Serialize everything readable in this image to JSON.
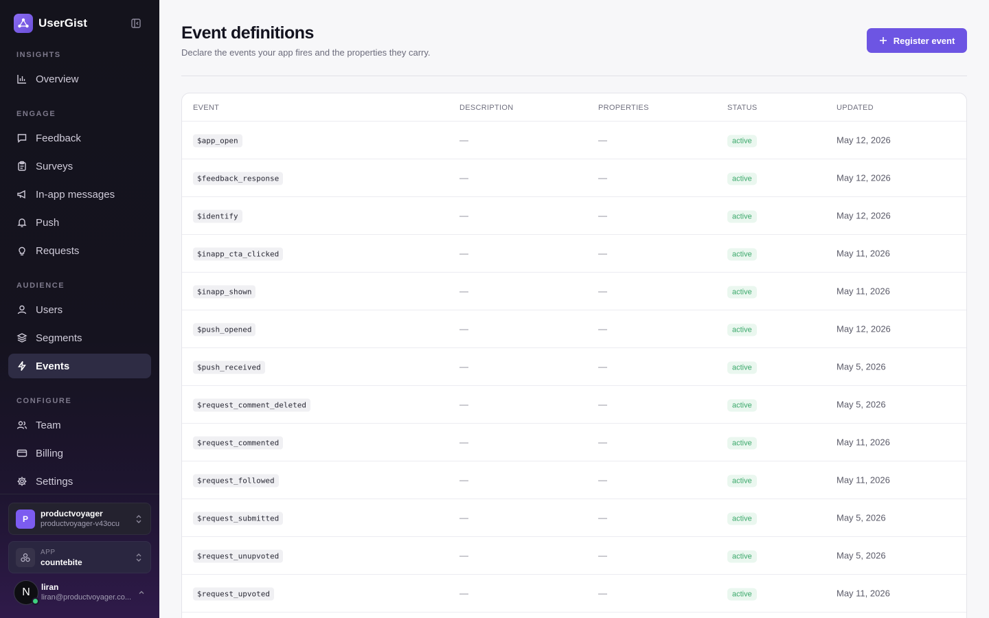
{
  "brand": {
    "name": "UserGist"
  },
  "sidebar": {
    "sections": [
      {
        "label": "INSIGHTS",
        "items": [
          {
            "label": "Overview",
            "icon": "bar-chart-icon"
          }
        ]
      },
      {
        "label": "ENGAGE",
        "items": [
          {
            "label": "Feedback",
            "icon": "message-square-icon"
          },
          {
            "label": "Surveys",
            "icon": "clipboard-icon"
          },
          {
            "label": "In-app messages",
            "icon": "megaphone-icon"
          },
          {
            "label": "Push",
            "icon": "bell-icon"
          },
          {
            "label": "Requests",
            "icon": "lightbulb-icon"
          }
        ]
      },
      {
        "label": "AUDIENCE",
        "items": [
          {
            "label": "Users",
            "icon": "user-icon"
          },
          {
            "label": "Segments",
            "icon": "layers-icon"
          },
          {
            "label": "Events",
            "icon": "bolt-icon",
            "active": true
          }
        ]
      },
      {
        "label": "CONFIGURE",
        "items": [
          {
            "label": "Team",
            "icon": "users-icon"
          },
          {
            "label": "Billing",
            "icon": "credit-card-icon"
          },
          {
            "label": "Settings",
            "icon": "gear-icon"
          }
        ]
      }
    ],
    "org": {
      "initial": "P",
      "name": "productvoyager",
      "slug": "productvoyager-v43ocu"
    },
    "app": {
      "label": "APP",
      "name": "countebite"
    },
    "user": {
      "initial": "N",
      "name": "liran",
      "email": "liran@productvoyager.co..."
    }
  },
  "page": {
    "title": "Event definitions",
    "subtitle": "Declare the events your app fires and the properties they carry.",
    "register_button": "Register event"
  },
  "table": {
    "columns": [
      "EVENT",
      "DESCRIPTION",
      "PROPERTIES",
      "STATUS",
      "UPDATED"
    ],
    "rows": [
      {
        "event": "$app_open",
        "description": "—",
        "properties": "—",
        "status": "active",
        "updated": "May 12, 2026"
      },
      {
        "event": "$feedback_response",
        "description": "—",
        "properties": "—",
        "status": "active",
        "updated": "May 12, 2026"
      },
      {
        "event": "$identify",
        "description": "—",
        "properties": "—",
        "status": "active",
        "updated": "May 12, 2026"
      },
      {
        "event": "$inapp_cta_clicked",
        "description": "—",
        "properties": "—",
        "status": "active",
        "updated": "May 11, 2026"
      },
      {
        "event": "$inapp_shown",
        "description": "—",
        "properties": "—",
        "status": "active",
        "updated": "May 11, 2026"
      },
      {
        "event": "$push_opened",
        "description": "—",
        "properties": "—",
        "status": "active",
        "updated": "May 12, 2026"
      },
      {
        "event": "$push_received",
        "description": "—",
        "properties": "—",
        "status": "active",
        "updated": "May 5, 2026"
      },
      {
        "event": "$request_comment_deleted",
        "description": "—",
        "properties": "—",
        "status": "active",
        "updated": "May 5, 2026"
      },
      {
        "event": "$request_commented",
        "description": "—",
        "properties": "—",
        "status": "active",
        "updated": "May 11, 2026"
      },
      {
        "event": "$request_followed",
        "description": "—",
        "properties": "—",
        "status": "active",
        "updated": "May 11, 2026"
      },
      {
        "event": "$request_submitted",
        "description": "—",
        "properties": "—",
        "status": "active",
        "updated": "May 5, 2026"
      },
      {
        "event": "$request_unupvoted",
        "description": "—",
        "properties": "—",
        "status": "active",
        "updated": "May 5, 2026"
      },
      {
        "event": "$request_upvoted",
        "description": "—",
        "properties": "—",
        "status": "active",
        "updated": "May 11, 2026"
      }
    ]
  },
  "colors": {
    "accent": "#6d55e3",
    "status_active": "#3aa86a",
    "sidebar_active_bg": "#2e2c44"
  }
}
